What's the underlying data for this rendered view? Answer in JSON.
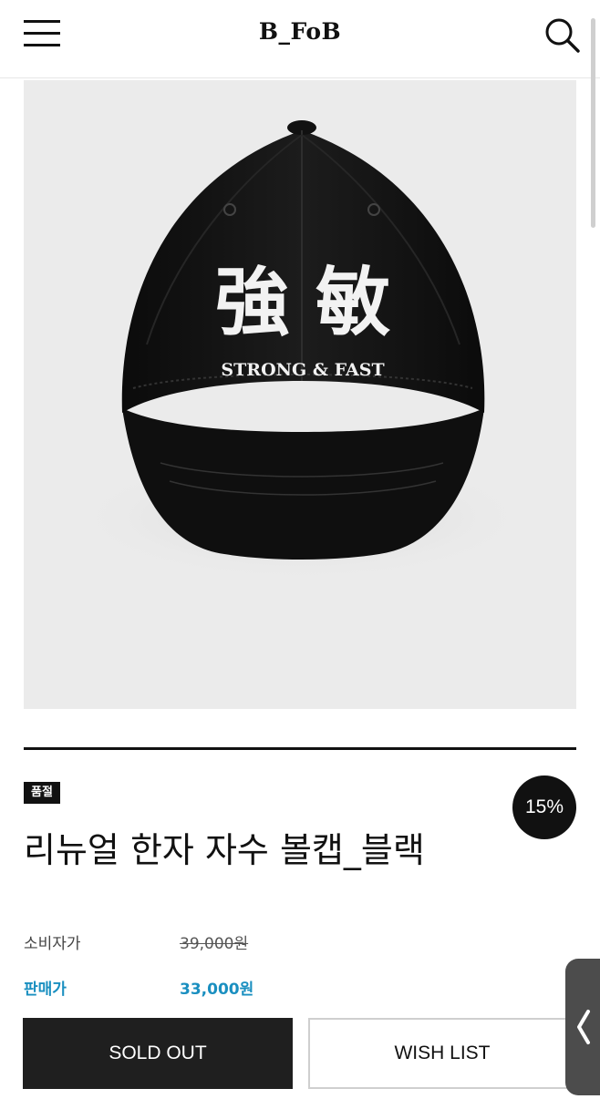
{
  "header": {
    "logo": "B_FoB"
  },
  "icons": {
    "menu": "hamburger-menu-icon",
    "search": "search-icon",
    "side_tab": "chevron-left-icon"
  },
  "product_image": {
    "kanji": "強 敏",
    "caption": "STRONG & FAST"
  },
  "product": {
    "badge": "품절",
    "discount": "15%",
    "title": "리뉴얼 한자 자수 볼캡_블랙",
    "consumer_price_label": "소비자가",
    "consumer_price": "39,000원",
    "sale_price_label": "판매가",
    "sale_price": "33,000원"
  },
  "buttons": {
    "sold_out": "SOLD OUT",
    "wish_list": "WISH LIST"
  },
  "colors": {
    "sale_price": "#1a8fc0",
    "button_dark": "#1f1f1f",
    "badge": "#111111"
  }
}
